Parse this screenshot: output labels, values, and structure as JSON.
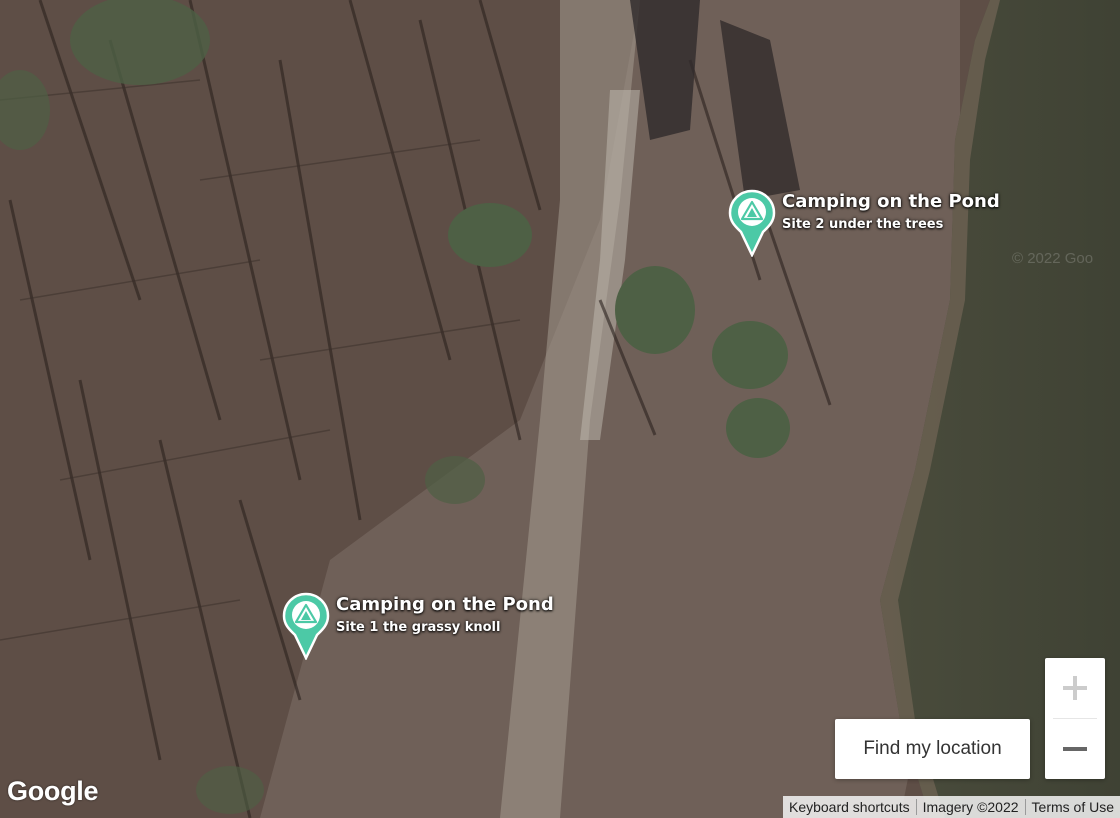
{
  "map": {
    "type": "satellite",
    "brand_color": "#4cc9a6"
  },
  "markers": [
    {
      "icon": "tent-icon",
      "title": "Camping on the Pond",
      "subtitle": "Site 2 under the trees"
    },
    {
      "icon": "tent-icon",
      "title": "Camping on the Pond",
      "subtitle": "Site 1 the grassy knoll"
    }
  ],
  "controls": {
    "zoom_in_icon": "plus-icon",
    "zoom_out_icon": "minus-icon",
    "find_location_label": "Find my location"
  },
  "branding": {
    "logo_text": "Google"
  },
  "attribution": {
    "keyboard_shortcuts": "Keyboard shortcuts",
    "imagery": "Imagery ©2022",
    "terms": "Terms of Use"
  },
  "watermark": "© 2022 Goo"
}
